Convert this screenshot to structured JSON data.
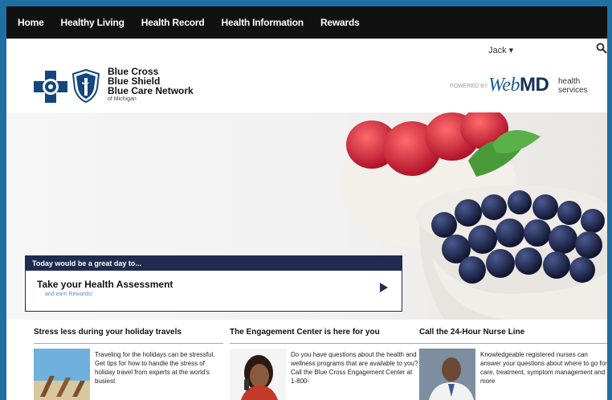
{
  "nav": {
    "items": [
      "Home",
      "Healthy Living",
      "Health Record",
      "Health Information",
      "Rewards"
    ]
  },
  "header": {
    "user_label": "Jack ▾",
    "brand": {
      "line1": "Blue Cross",
      "line2": "Blue Shield",
      "line3": "Blue Care Network",
      "line4": "of Michigan"
    },
    "powered_by": "POWERED BY",
    "webmd_web": "Web",
    "webmd_md": "MD",
    "health_services_1": "health",
    "health_services_2": "services"
  },
  "hero": {
    "banner_head": "Today would be a great day to...",
    "cta_title": "Take your Health Assessment",
    "cta_sub": "and earn Rewards!"
  },
  "columns": [
    {
      "title": "Stress less during your holiday travels",
      "body": "Traveling for the holidays can be stressful. Get tips for how to handle the stress of holiday travel from experts at the world's busiest"
    },
    {
      "title": "The Engagement Center is here for you",
      "body": "Do you have questions about the health and wellness programs that are available to you? Call the Blue Cross Engagement Center at 1-800-"
    },
    {
      "title": "Call the 24-Hour Nurse Line",
      "body": "Knowledgeable registered nurses can answer your questions about where to go for care, treatment, symptom management and more"
    }
  ],
  "colors": {
    "nav_bg": "#111111",
    "banner_bg": "#1f2c50",
    "brand_blue": "#1a4f8a",
    "frame_blue": "#1f6fa3"
  }
}
